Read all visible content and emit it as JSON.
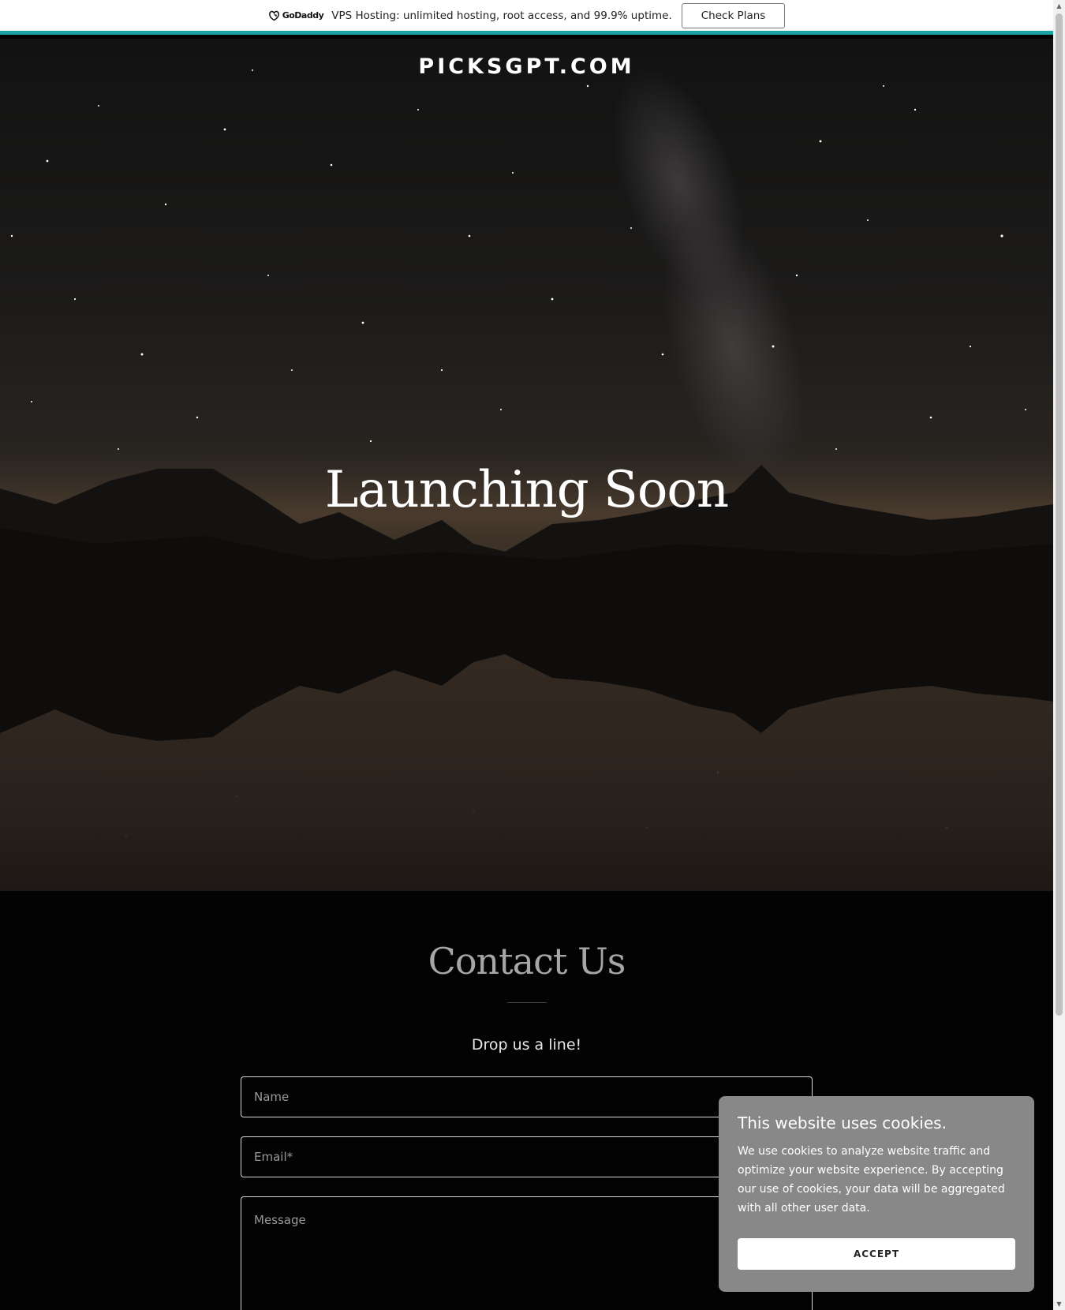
{
  "promo": {
    "brand": "GoDaddy",
    "text": "VPS Hosting: unlimited hosting, root access, and 99.9% uptime.",
    "button_label": "Check Plans",
    "accent_color": "#1ba3a3"
  },
  "hero": {
    "site_title": "PICKSGPT.COM",
    "heading": "Launching Soon"
  },
  "contact": {
    "title": "Contact Us",
    "subtitle": "Drop us a line!",
    "name_placeholder": "Name",
    "email_placeholder": "Email*",
    "message_placeholder": "Message"
  },
  "cookie": {
    "title": "This website uses cookies.",
    "body": "We use cookies to analyze website traffic and optimize your website experience. By accepting our use of cookies, your data will be aggregated with all other user data.",
    "accept_label": "ACCEPT"
  },
  "icons": {
    "brand_logo": "godaddy-logo-icon",
    "scroll_up": "chevron-up-icon",
    "scroll_down": "chevron-down-icon"
  }
}
